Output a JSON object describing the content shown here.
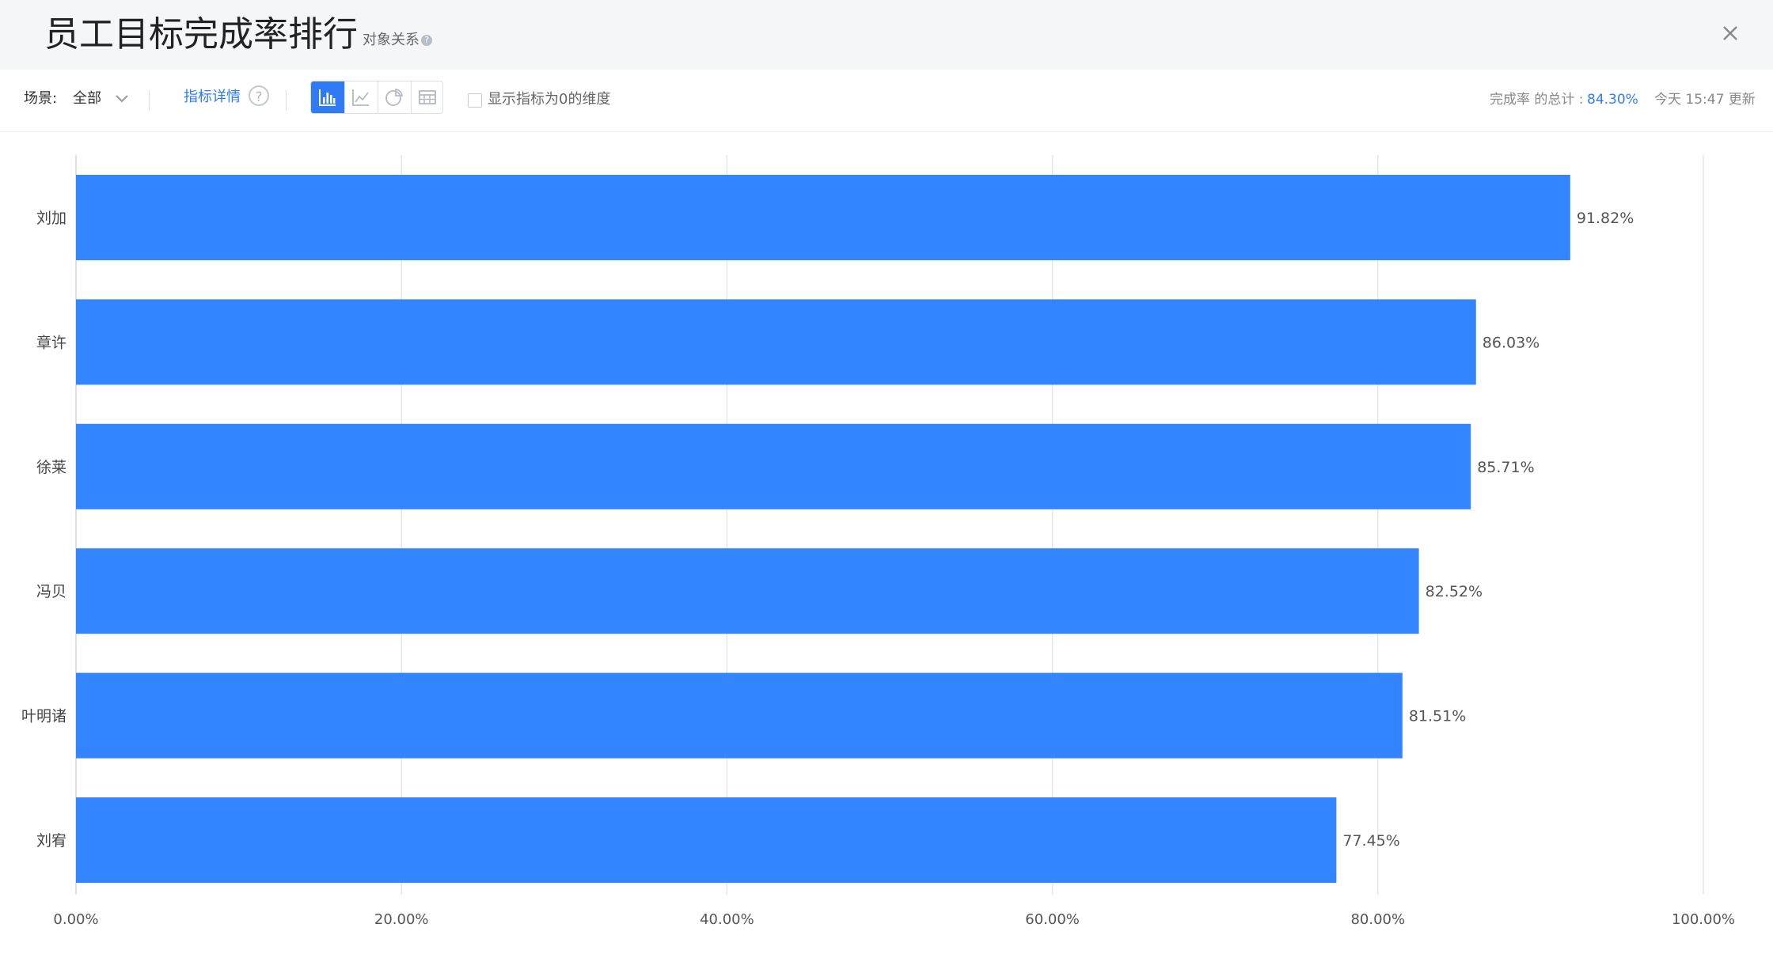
{
  "header": {
    "title": "员工目标完成率排行",
    "subtitle": "对象关系",
    "help_glyph": "?",
    "close_icon": "close-icon"
  },
  "toolbar": {
    "scene_label": "场景:",
    "scene_value": "全部",
    "detail_link": "指标详情",
    "help_glyph": "?",
    "view_modes": [
      "bar-chart-icon",
      "line-chart-icon",
      "pie-chart-icon",
      "table-icon"
    ],
    "active_view": "bar-chart-icon",
    "show_zero_label": "显示指标为0的维度",
    "total_label": "完成率 的总计 :",
    "total_value": "84.30%",
    "updated": "今天 15:47 更新"
  },
  "colors": {
    "bar": "#3385ff",
    "accent": "#2f7bf5",
    "grid": "#e4e6eb"
  },
  "chart_data": {
    "type": "bar",
    "orientation": "horizontal",
    "categories": [
      "刘加",
      "章许",
      "徐莱",
      "冯贝",
      "叶明诸",
      "刘宥"
    ],
    "values": [
      91.82,
      86.03,
      85.71,
      82.52,
      81.51,
      77.45
    ],
    "value_labels": [
      "91.82%",
      "86.03%",
      "85.71%",
      "82.52%",
      "81.51%",
      "77.45%"
    ],
    "x_ticks": [
      0,
      20,
      40,
      60,
      80,
      100
    ],
    "x_tick_labels": [
      "0.00%",
      "20.00%",
      "40.00%",
      "60.00%",
      "80.00%",
      "100.00%"
    ],
    "xlim": [
      0,
      100
    ],
    "grid": true
  }
}
